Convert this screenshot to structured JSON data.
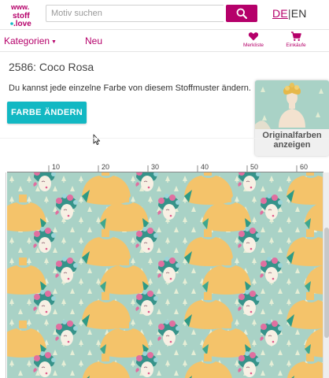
{
  "header": {
    "logo_text": "www.stoff.love",
    "search_placeholder": "Motiv suchen",
    "lang_de": "DE",
    "lang_sep": "|",
    "lang_en": "EN"
  },
  "nav": {
    "categories_label": "Kategorien",
    "new_label": "Neu",
    "wishlist_label": "Merkliste",
    "cart_label": "Einkäufe"
  },
  "main": {
    "title": "2586: Coco Rosa",
    "description": "Du kannst jede einzelne Farbe von diesem Stoffmuster ändern.",
    "change_color_button": "FARBE ÄNDERN",
    "original_colors_line1": "Originalfarben",
    "original_colors_line2": "anzeigen"
  },
  "ruler": {
    "labels": [
      "10",
      "20",
      "30",
      "40",
      "50",
      "60"
    ]
  },
  "colors": {
    "brand": "#b5006a",
    "accent": "#12b8c3",
    "fabric_bg": "#a9d2c6",
    "bust_yellow": "#f4c36a",
    "bust_shadow": "#2d9a86",
    "hair_teal": "#36938a",
    "flower_pink": "#e06fa0"
  }
}
